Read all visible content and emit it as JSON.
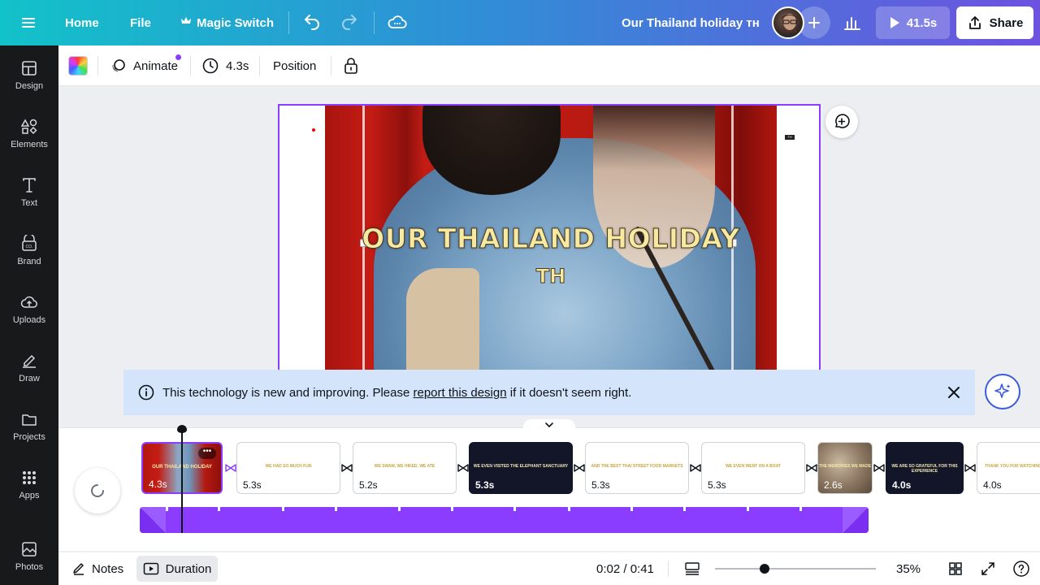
{
  "topbar": {
    "home": "Home",
    "file": "File",
    "magic_switch": "Magic Switch",
    "doc_title": "Our Thailand holiday ᴛʜ",
    "play_duration": "41.5s",
    "share": "Share"
  },
  "sidebar": {
    "items": [
      {
        "label": "Design",
        "icon": "layout-icon"
      },
      {
        "label": "Elements",
        "icon": "shapes-icon"
      },
      {
        "label": "Text",
        "icon": "text-icon"
      },
      {
        "label": "Brand",
        "icon": "brand-icon"
      },
      {
        "label": "Uploads",
        "icon": "upload-cloud-icon"
      },
      {
        "label": "Draw",
        "icon": "pen-icon"
      },
      {
        "label": "Projects",
        "icon": "folder-icon"
      },
      {
        "label": "Apps",
        "icon": "apps-grid-icon"
      },
      {
        "label": "Photos",
        "icon": "image-icon"
      }
    ]
  },
  "toolbar": {
    "animate": "Animate",
    "duration": "4.3s",
    "position": "Position"
  },
  "canvas": {
    "title": "OUR THAILAND HOLIDAY",
    "subtitle": "TH",
    "badge": "TH"
  },
  "banner": {
    "text_before": "This technology is new and improving. Please ",
    "link": "report this design",
    "text_after": " if it doesn't seem right."
  },
  "timeline": {
    "scenes": [
      {
        "duration": "4.3s",
        "caption": "OUR THAILAND HOLIDAY",
        "style": "photo"
      },
      {
        "duration": "5.3s",
        "caption": "WE HAD SO MUCH FUN",
        "style": "light"
      },
      {
        "duration": "5.2s",
        "caption": "WE SWAM, WE HIKED, WE ATE",
        "style": "light"
      },
      {
        "duration": "5.3s",
        "caption": "WE EVEN VISITED THE ELEPHANT SANCTUARY",
        "style": "dark"
      },
      {
        "duration": "5.3s",
        "caption": "AND THE BEST THAI STREET FOOD MARKETS",
        "style": "light"
      },
      {
        "duration": "5.3s",
        "caption": "WE EVEN WENT ON A BOAT",
        "style": "light"
      },
      {
        "duration": "2.6s",
        "caption": "THE MEMORIES WE MADE",
        "style": "rock"
      },
      {
        "duration": "4.0s",
        "caption": "WE ARE SO GRATEFUL FOR THIS EXPERIENCE",
        "style": "dark"
      },
      {
        "duration": "4.0s",
        "caption": "THANK YOU FOR WATCHING",
        "style": "light"
      }
    ]
  },
  "bottombar": {
    "notes": "Notes",
    "duration": "Duration",
    "time": "0:02 / 0:41",
    "zoom": "35%"
  },
  "colors": {
    "accent": "#8b3dff",
    "sidebar_bg": "#18191b",
    "banner_bg": "#d4e4fb"
  }
}
